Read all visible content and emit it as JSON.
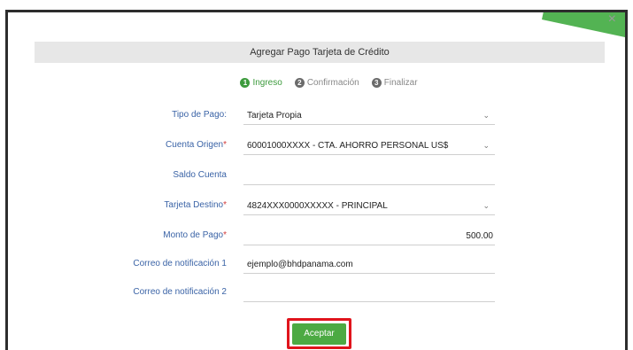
{
  "dialog": {
    "title": "Agregar Pago Tarjeta de Crédito",
    "close_glyph": "×"
  },
  "steps": [
    {
      "number": "1",
      "label": "Ingreso",
      "active": true
    },
    {
      "number": "2",
      "label": "Confirmación",
      "active": false
    },
    {
      "number": "3",
      "label": "Finalizar",
      "active": false
    }
  ],
  "form": {
    "tipo_pago": {
      "label": "Tipo de Pago:",
      "value": "Tarjeta Propia"
    },
    "cuenta_origen": {
      "label": "Cuenta Origen",
      "required": "*",
      "value": "60001000XXXX - CTA. AHORRO PERSONAL US$"
    },
    "saldo_cuenta": {
      "label": "Saldo Cuenta",
      "value": ""
    },
    "tarjeta_destino": {
      "label": "Tarjeta Destino",
      "required": "*",
      "value": "4824XXX0000XXXXX - PRINCIPAL"
    },
    "monto_pago": {
      "label": "Monto de Pago",
      "required": "*",
      "value": "500.00"
    },
    "correo_1": {
      "label": "Correo de notificación 1",
      "value": "ejemplo@bhdpanama.com"
    },
    "correo_2": {
      "label": "Correo de notificación 2",
      "value": ""
    }
  },
  "actions": {
    "accept_label": "Aceptar"
  },
  "colors": {
    "accent_green": "#4caa43",
    "highlight_red": "#e0141c",
    "label_blue": "#3a63a6"
  }
}
